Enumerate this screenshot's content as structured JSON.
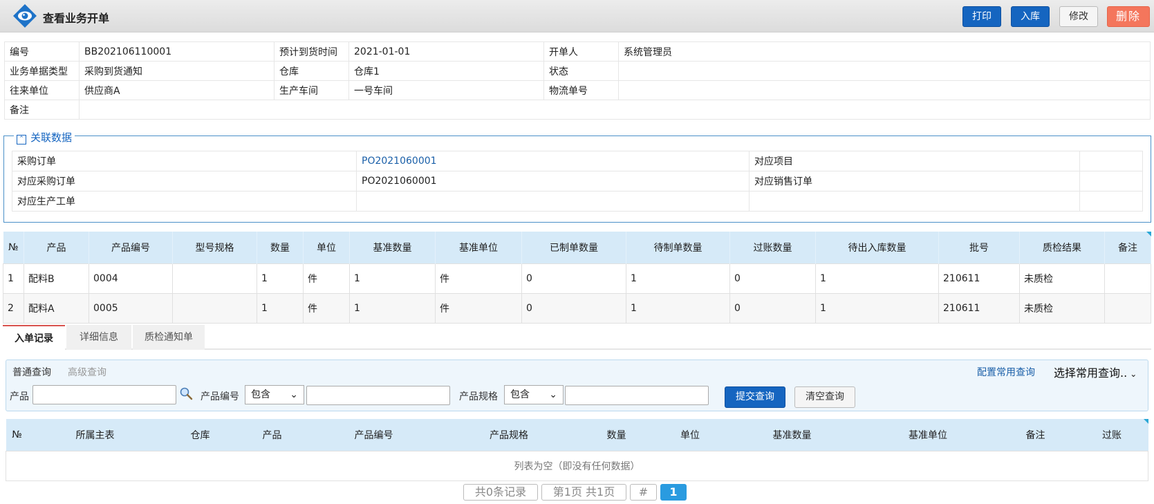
{
  "header": {
    "title": "查看业务开单",
    "buttons": {
      "print": "打印",
      "stock_in": "入库",
      "edit": "修改",
      "delete": "删除"
    }
  },
  "info": {
    "rows": [
      [
        {
          "label": "编号",
          "value": "BB202106110001"
        },
        {
          "label": "预计到货时间",
          "value": "2021-01-01"
        },
        {
          "label": "开单人",
          "value": "系统管理员"
        }
      ],
      [
        {
          "label": "业务单据类型",
          "value": "采购到货通知"
        },
        {
          "label": "仓库",
          "value": "仓库1"
        },
        {
          "label": "状态",
          "value": ""
        }
      ],
      [
        {
          "label": "往来单位",
          "value": "供应商A"
        },
        {
          "label": "生产车间",
          "value": "一号车间"
        },
        {
          "label": "物流单号",
          "value": ""
        }
      ]
    ],
    "remark_label": "备注",
    "remark_value": ""
  },
  "related": {
    "legend": "关联数据",
    "rows": [
      {
        "l1": "采购订单",
        "v1": "PO2021060001",
        "l2": "对应项目",
        "v2": ""
      },
      {
        "l1": "对应采购订单",
        "v1": "PO2021060001",
        "l2": "对应销售订单",
        "v2": ""
      },
      {
        "l1": "对应生产工单",
        "v1": "",
        "l2": "",
        "v2": ""
      }
    ]
  },
  "detail": {
    "columns": [
      "№",
      "产品",
      "产品编号",
      "型号规格",
      "数量",
      "单位",
      "基准数量",
      "基准单位",
      "已制单数量",
      "待制单数量",
      "过账数量",
      "待出入库数量",
      "批号",
      "质检结果",
      "备注"
    ],
    "rows": [
      [
        "1",
        "配料B",
        "0004",
        "",
        "1",
        "件",
        "1",
        "件",
        "0",
        "1",
        "0",
        "1",
        "210611",
        "未质检",
        ""
      ],
      [
        "2",
        "配料A",
        "0005",
        "",
        "1",
        "件",
        "1",
        "件",
        "0",
        "1",
        "0",
        "1",
        "210611",
        "未质检",
        ""
      ]
    ]
  },
  "tabs": [
    "入单记录",
    "详细信息",
    "质检通知单"
  ],
  "query": {
    "simple": "普通查询",
    "advanced": "高级查询",
    "config_link": "配置常用查询",
    "common_select": "选择常用查询..",
    "product_label": "产品",
    "code_label": "产品编号",
    "code_op": "包含",
    "spec_label": "产品规格",
    "spec_op": "包含",
    "submit": "提交查询",
    "clear": "清空查询"
  },
  "list": {
    "columns": [
      "№",
      "所属主表",
      "仓库",
      "产品",
      "产品编号",
      "产品规格",
      "数量",
      "单位",
      "基准数量",
      "基准单位",
      "备注",
      "过账"
    ],
    "empty_text": "列表为空（即没有任何数据）"
  },
  "pager": {
    "total": "共0条记录",
    "page_info": "第1页 共1页",
    "hash": "#",
    "current": "1"
  }
}
